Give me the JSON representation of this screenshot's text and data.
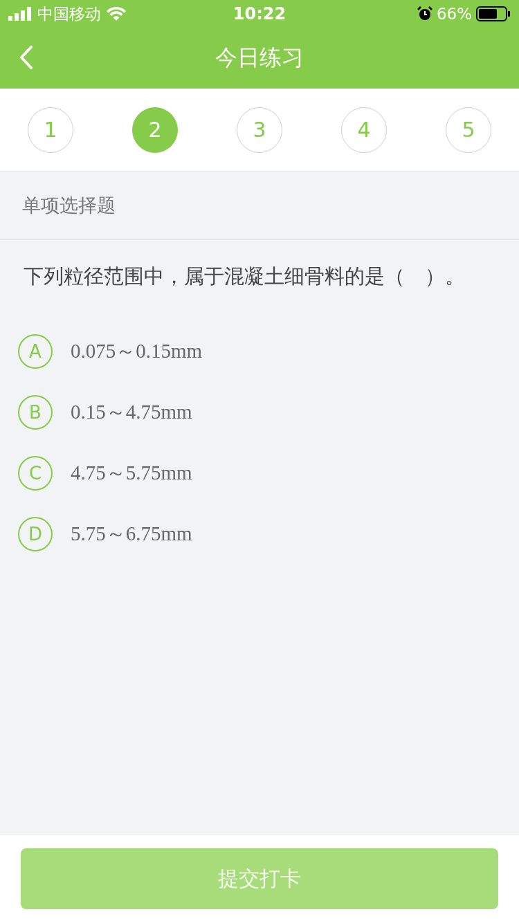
{
  "status_bar": {
    "carrier": "中国移动",
    "time": "10:22",
    "battery_text": "66%"
  },
  "header": {
    "title": "今日练习"
  },
  "question_tabs": [
    {
      "label": "1",
      "selected": false
    },
    {
      "label": "2",
      "selected": true
    },
    {
      "label": "3",
      "selected": false
    },
    {
      "label": "4",
      "selected": false
    },
    {
      "label": "5",
      "selected": false
    }
  ],
  "section_label": "单项选择题",
  "question": "下列粒径范围中，属于混凝土细骨料的是（　）。",
  "options": [
    {
      "letter": "A",
      "text": "0.075～0.15mm",
      "selected": false
    },
    {
      "letter": "B",
      "text": "0.15～4.75mm",
      "selected": false
    },
    {
      "letter": "C",
      "text": "4.75～5.75mm",
      "selected": false
    },
    {
      "letter": "D",
      "text": "5.75～6.75mm",
      "selected": false
    }
  ],
  "submit_button": {
    "label": "提交打卡",
    "disabled": true
  }
}
